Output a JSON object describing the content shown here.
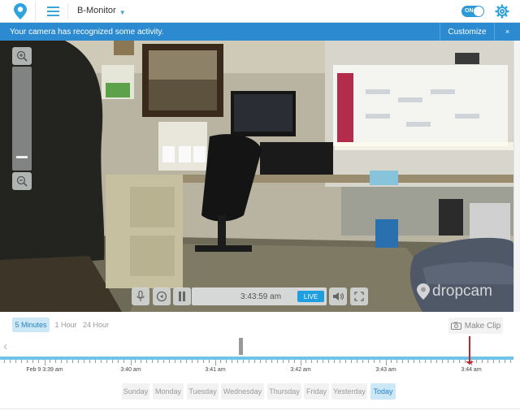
{
  "header": {
    "camera_name": "B-Monitor",
    "toggle_label": "ON"
  },
  "notification": {
    "message": "Your camera has recognized some activity.",
    "customize_label": "Customize",
    "close_label": "×"
  },
  "player": {
    "time": "3:43:59 am",
    "live_label": "LIVE",
    "watermark": "dropcam"
  },
  "range": {
    "options": [
      "5 Minutes",
      "1 Hour",
      "24 Hour"
    ],
    "selected": "5 Minutes",
    "make_clip_label": "Make Clip"
  },
  "timeline": {
    "labels": [
      "Feb 9 3:39 am",
      "3:40 am",
      "3:41 am",
      "3:42 am",
      "3:43 am",
      "3:44 am"
    ]
  },
  "days": {
    "items": [
      "Sunday",
      "Monday",
      "Tuesday",
      "Wednesday",
      "Thursday",
      "Friday",
      "Yesterday",
      "Today"
    ],
    "selected": "Today"
  },
  "colors": {
    "accent": "#2b8ad0",
    "timeline": "#6ec3e6",
    "now_marker": "#c0272d"
  }
}
